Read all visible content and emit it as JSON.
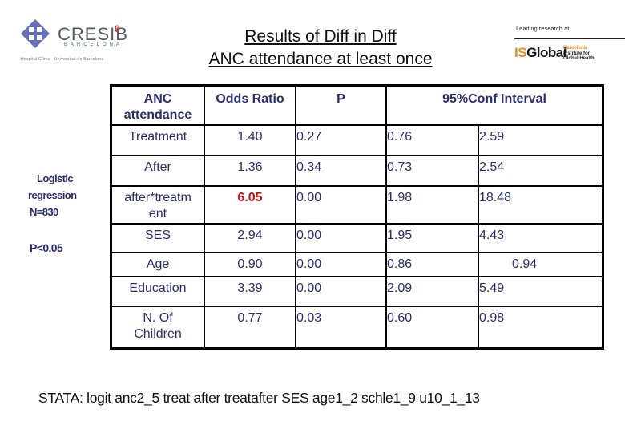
{
  "header": {
    "title_line1": "Results of Diff in Diff",
    "title_line2": "ANC attendance at least once",
    "left_logo": {
      "name": "CRESIB",
      "flag": "9",
      "city": "BARCELONA",
      "subtitle": "Hospital Clínic - Universitat de Barcelona"
    },
    "right_logo": {
      "lead_text": "Leading research at",
      "brand_is": "IS",
      "brand_global": "Global",
      "small_line1": "Barcelona",
      "small_line2": "Institute for",
      "small_line3": "Global Health"
    }
  },
  "side_notes": {
    "line1": "Logistic",
    "line2": "regression",
    "line3": "N=830",
    "line4": "P<0.05"
  },
  "table": {
    "headers": [
      "ANC attendance",
      "Odds Ratio",
      "P",
      "95%Conf Interval"
    ],
    "header_anc_line1": "ANC",
    "header_anc_line2": "attendance",
    "rows": [
      {
        "label": "Treatment",
        "or": "1.40",
        "p": "0.27",
        "ci_low": "0.76",
        "ci_high": "2.59"
      },
      {
        "label": "After",
        "or": "1.36",
        "p": "0.34",
        "ci_low": "0.73",
        "ci_high": "2.54"
      },
      {
        "label": "after*treatment",
        "label_l1": "after*treatm",
        "label_l2": "ent",
        "or": "6.05",
        "p": "0.00",
        "ci_low": "1.98",
        "ci_high": "18.48",
        "highlight_or": true
      },
      {
        "label": "SES",
        "or": "2.94",
        "p": "0.00",
        "ci_low": "1.95",
        "ci_high": "4.43"
      },
      {
        "label": "Age",
        "or": "0.90",
        "p": "0.00",
        "ci_low": "0.86",
        "ci_high": "0.94"
      },
      {
        "label": "Education",
        "or": "3.39",
        "p": "0.00",
        "ci_low": "2.09",
        "ci_high": "5.49"
      },
      {
        "label": "N. Of Children",
        "label_l1": "N. Of",
        "label_l2": "Children",
        "or": "0.77",
        "p": "0.03",
        "ci_low": "0.60",
        "ci_high": "0.98"
      }
    ],
    "highlight_color": "#c0141a",
    "text_color": "#2b2f6e"
  },
  "footer": {
    "stata_command": "STATA: logit anc2_5 treat after treatafter SES age1_2 schle1_9 u10_1_13"
  }
}
